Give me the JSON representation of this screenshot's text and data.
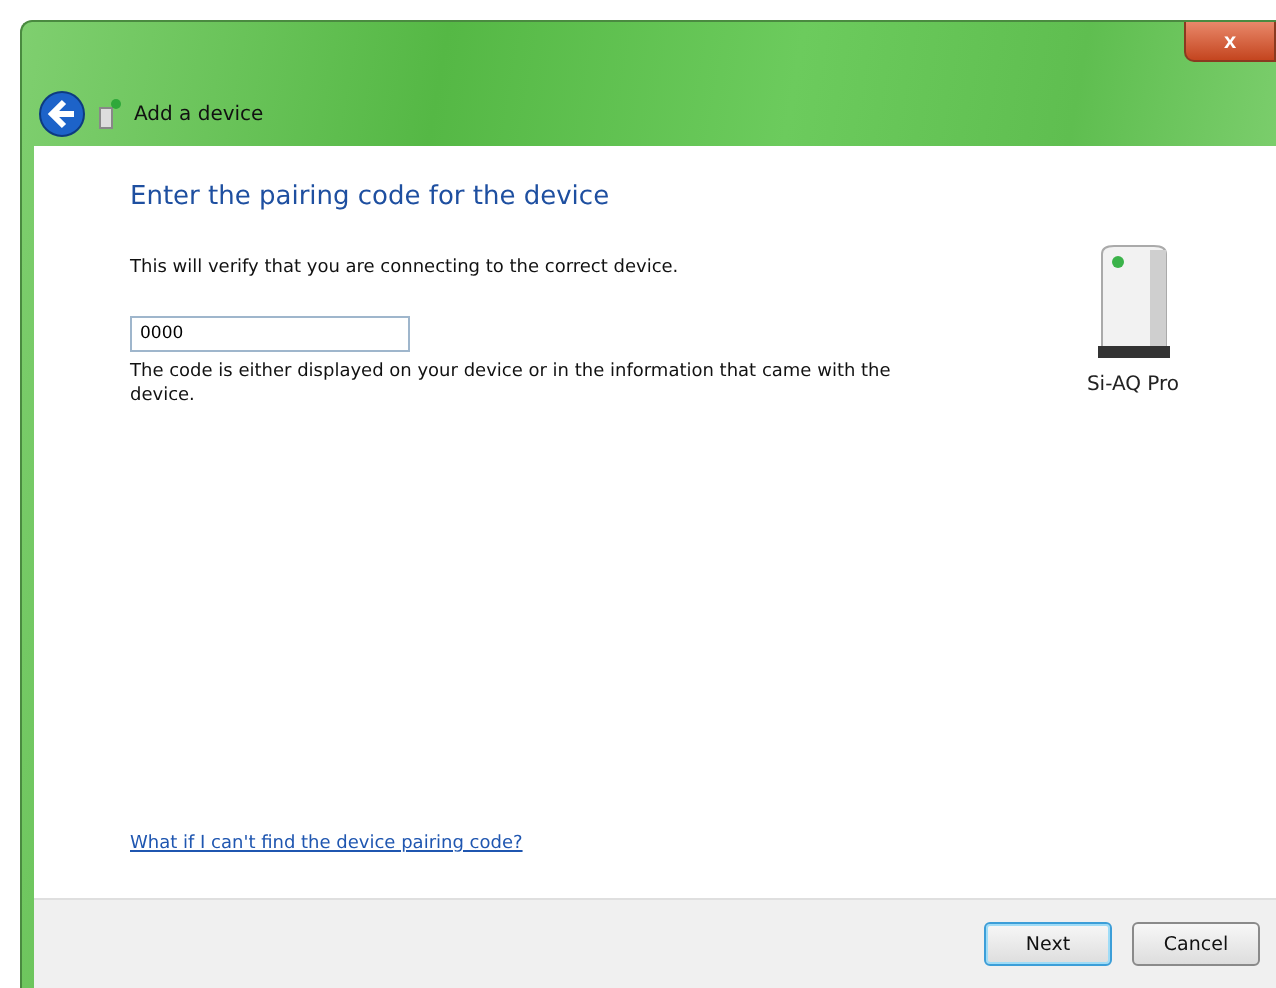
{
  "window": {
    "title": "Add a device",
    "close": "x"
  },
  "heading": "Enter the pairing code for the device",
  "intro": "This will verify that you are connecting to the correct device.",
  "code_field": {
    "value": "0000"
  },
  "hint": "The code is either displayed on your device or in the information that came with the device.",
  "device": {
    "name": "Si-AQ Pro"
  },
  "help_link": "What if I can't find the device pairing code?",
  "buttons": [
    {
      "label": "Next",
      "selected": true
    },
    {
      "label": "Cancel",
      "selected": false
    }
  ]
}
